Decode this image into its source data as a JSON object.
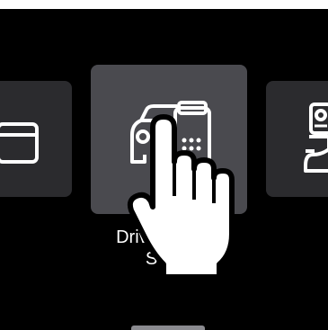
{
  "carousel": {
    "items": [
      {
        "icon": "window-icon"
      },
      {
        "icon": "driver-id-setup-icon",
        "label_line1": "Driver ID and",
        "label_line2": "Setup",
        "selected": true
      },
      {
        "icon": "person-badge-icon"
      }
    ],
    "gesture": "tap-hand-icon"
  },
  "colors": {
    "background": "#000000",
    "tile_selected": "#4a4a4f",
    "tile_unselected": "#2b2b2e",
    "text": "#ffffff",
    "indicator": "#8a8a8f"
  }
}
